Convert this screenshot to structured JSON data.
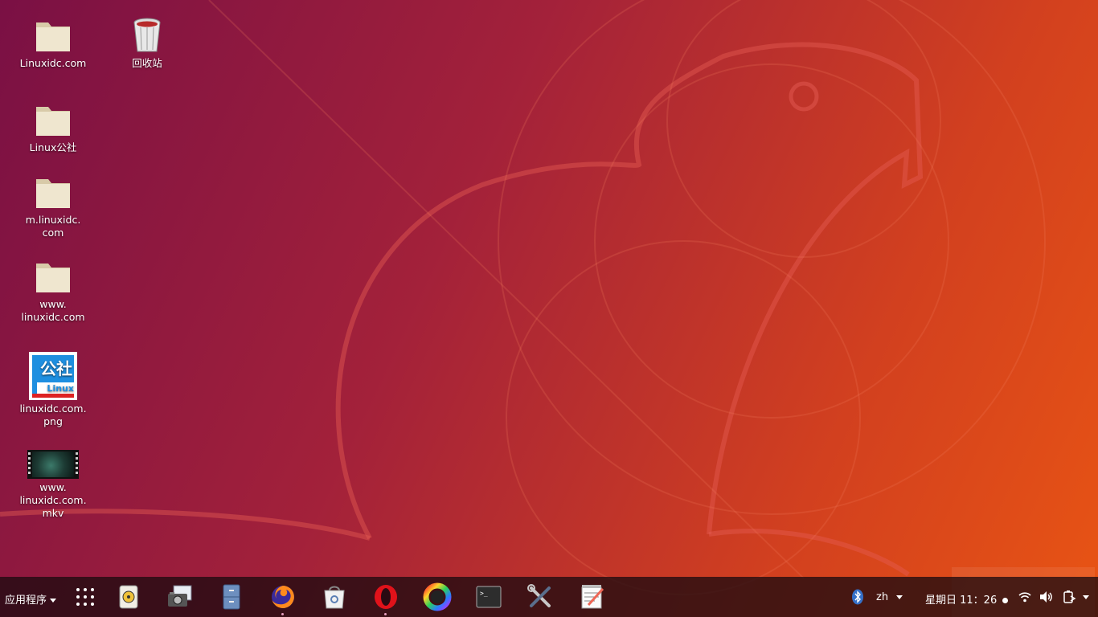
{
  "desktop": {
    "icons": [
      {
        "label": "Linuxidc.com"
      },
      {
        "label": "回收站"
      },
      {
        "label": "Linux公社"
      },
      {
        "label": "m.linuxidc.\ncom"
      },
      {
        "label": "www.\nlinuxidc.com"
      },
      {
        "label": "linuxidc.com.\npng"
      },
      {
        "label": "www.\nlinuxidc.com.\nmkv"
      }
    ],
    "thumbnail_text": {
      "top": "公社",
      "bottom": "Linux"
    }
  },
  "taskbar": {
    "app_menu_label": "应用程序",
    "dock_icons": [
      "apps-grid-icon",
      "rhythmbox-icon",
      "screenshot-icon",
      "files-icon",
      "firefox-icon",
      "software-center-icon",
      "opera-icon",
      "color-picker-icon",
      "terminal-icon",
      "settings-tools-icon",
      "text-editor-icon"
    ],
    "tray": {
      "language": "zh",
      "clock": "星期日 11：26",
      "icons": [
        "bluetooth-icon",
        "wifi-icon",
        "volume-icon",
        "battery-icon"
      ]
    }
  },
  "colors": {
    "accent": "#e95420",
    "wallpaper_start": "#7a1044",
    "wallpaper_end": "#e85414"
  }
}
